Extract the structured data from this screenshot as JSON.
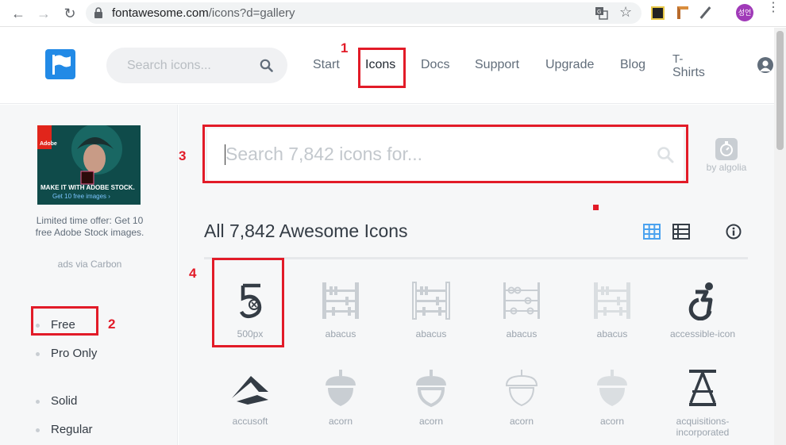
{
  "browser": {
    "url_host": "fontawesome.com",
    "url_path": "/icons?d=gallery",
    "profile_badge": "성언"
  },
  "header": {
    "search_placeholder": "Search icons...",
    "nav": [
      "Start",
      "Icons",
      "Docs",
      "Support",
      "Upgrade",
      "Blog",
      "T-",
      "Shirts"
    ]
  },
  "sidebar": {
    "ad_brand": "Adobe",
    "ad_headline": "MAKE IT WITH ADOBE STOCK.",
    "ad_cta": "Get 10 free images ›",
    "ad_text": "Limited time offer: Get 10 free Adobe Stock images.",
    "ad_via": "ads via Carbon",
    "filters": [
      "Free",
      "Pro Only",
      "Solid",
      "Regular"
    ]
  },
  "main": {
    "search_placeholder": "Search 7,842 icons for...",
    "algolia": "by algolia",
    "title": "All 7,842 Awesome Icons",
    "icons": [
      {
        "name": "500px"
      },
      {
        "name": "abacus"
      },
      {
        "name": "abacus"
      },
      {
        "name": "abacus"
      },
      {
        "name": "abacus"
      },
      {
        "name": "accessible-icon"
      },
      {
        "name": "accusoft"
      },
      {
        "name": "acorn"
      },
      {
        "name": "acorn"
      },
      {
        "name": "acorn"
      },
      {
        "name": "acorn"
      },
      {
        "name": "acquisitions-",
        "name2": "incorporated"
      }
    ]
  },
  "annotations": [
    "1",
    "2",
    "3",
    "4"
  ],
  "colors": {
    "brand": "#228ae6",
    "annotation_red": "#e21b28"
  }
}
